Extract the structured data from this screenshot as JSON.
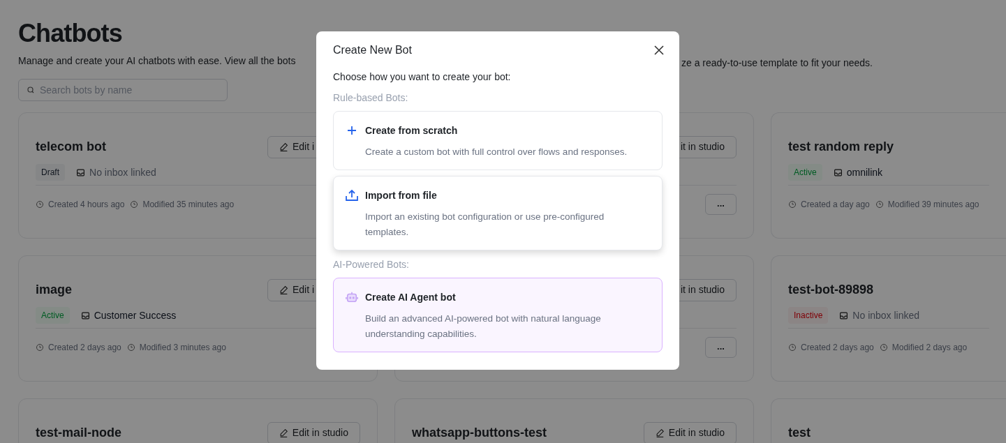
{
  "page": {
    "title": "Chatbots",
    "description_left": "Manage and create your AI chatbots with ease. View all the bots",
    "description_right": "ze a ready-to-use template to fit your needs.",
    "search": {
      "placeholder": "Search bots by name"
    },
    "bots": [
      {
        "name": "telecom bot",
        "status": {
          "label": "Draft",
          "kind": "draft"
        },
        "inbox": {
          "label": "No inbox linked",
          "linked": false
        },
        "created": "Created 4 hours ago",
        "modified": "Modified 35 minutes ago",
        "edit": {
          "label": "Edit i",
          "icon": true
        }
      },
      {
        "edit": {
          "label": "it in studio",
          "icon": false
        },
        "more": "..."
      },
      {
        "name": "test random reply",
        "status": {
          "label": "Active",
          "kind": "active"
        },
        "inbox": {
          "label": "omnilink",
          "linked": true
        },
        "created": "Created a day ago",
        "modified": "Modified 39 minutes ago"
      },
      {
        "name": "image",
        "status": {
          "label": "Active",
          "kind": "active"
        },
        "inbox": {
          "label": "Customer Success",
          "linked": true
        },
        "created": "Created 2 days ago",
        "modified": "Modified 3 minutes ago",
        "edit": {
          "label": "Edit i",
          "icon": true
        }
      },
      {
        "edit": {
          "label": "it in studio",
          "icon": false
        },
        "more": "..."
      },
      {
        "name": "test-bot-89898",
        "status": {
          "label": "Inactive",
          "kind": "inactive"
        },
        "inbox": {
          "label": "No inbox linked",
          "linked": false
        },
        "created": "Created 2 days ago",
        "modified": "Modified 2 days ago"
      },
      {
        "name": "test-mail-node",
        "edit": {
          "label": "Edit in studio",
          "icon": true
        }
      },
      {
        "name": "whatsapp-buttons-test",
        "edit": {
          "label": "Edit in studio",
          "icon": true
        }
      },
      {
        "name": "test"
      }
    ]
  },
  "modal": {
    "title": "Create New Bot",
    "prompt": "Choose how you want to create your bot:",
    "sections": [
      {
        "label": "Rule-based Bots:",
        "options": [
          {
            "kind": "scratch",
            "title": "Create from scratch",
            "description": "Create a custom bot with full control over flows and responses.",
            "hovered": false,
            "selected": false
          },
          {
            "kind": "import",
            "title": "Import from file",
            "description": "Import an existing bot configuration or use pre-configured templates.",
            "hovered": true,
            "selected": false
          }
        ]
      },
      {
        "label": "AI-Powered Bots:",
        "options": [
          {
            "kind": "ai",
            "title": "Create AI Agent bot",
            "description": "Build an advanced AI-powered bot with natural language understanding capabilities.",
            "hovered": false,
            "selected": true
          }
        ]
      }
    ]
  }
}
